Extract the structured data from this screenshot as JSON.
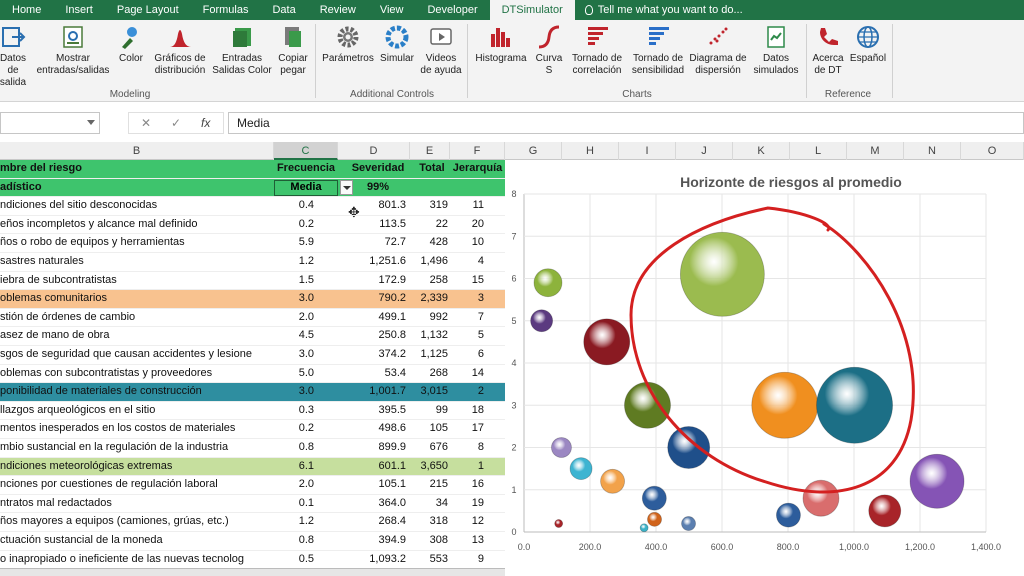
{
  "menu": {
    "tabs": [
      "Home",
      "Insert",
      "Page Layout",
      "Formulas",
      "Data",
      "Review",
      "View",
      "Developer",
      "DTSimulator"
    ],
    "active": "DTSimulator",
    "tell_me": "Tell me what you want to do..."
  },
  "ribbon": {
    "buttons": [
      {
        "label": "Datos\nde salida",
        "icon": "data-output-icon"
      },
      {
        "label": "Mostrar\nentradas/salidas",
        "icon": "show-io-icon"
      },
      {
        "label": "Color",
        "icon": "color-icon"
      },
      {
        "label": "Gráficos de\ndistribución",
        "icon": "distribution-icon"
      },
      {
        "label": "Entradas\nSalidas Color",
        "icon": "io-color-icon"
      },
      {
        "label": "Copiar\npegar",
        "icon": "copy-paste-icon"
      },
      {
        "label": "Parámetros",
        "icon": "gear-icon"
      },
      {
        "label": "Simular",
        "icon": "simulate-icon"
      },
      {
        "label": "Videos\nde ayuda",
        "icon": "video-icon"
      },
      {
        "label": "Histograma",
        "icon": "histogram-icon"
      },
      {
        "label": "Curva\nS",
        "icon": "s-curve-icon"
      },
      {
        "label": "Tornado de\ncorrelación",
        "icon": "tornado-correlation-icon"
      },
      {
        "label": "Tornado de\nsensibilidad",
        "icon": "tornado-sensitivity-icon"
      },
      {
        "label": "Diagrama de\ndispersión",
        "icon": "scatter-icon"
      },
      {
        "label": "Datos\nsimulados",
        "icon": "simulated-data-icon"
      },
      {
        "label": "Acerca\nde DT",
        "icon": "about-icon"
      },
      {
        "label": "Español",
        "icon": "globe-icon"
      }
    ],
    "groups": [
      "Modeling",
      "Additional Controls",
      "Charts",
      "Reference"
    ]
  },
  "formula_bar": {
    "value": "Media",
    "fx": "fx"
  },
  "columns": [
    "B",
    "C",
    "D",
    "E",
    "F",
    "G",
    "H",
    "I",
    "J",
    "K",
    "L",
    "M",
    "N",
    "O"
  ],
  "table": {
    "header1": {
      "b": "mbre del riesgo",
      "c": "Frecuencia",
      "d": "Severidad",
      "e": "Total",
      "f": "Jerarquía"
    },
    "header2": {
      "b": "adístico",
      "c": "Media",
      "d": "99%"
    },
    "rows": [
      {
        "b": "ndiciones del sitio desconocidas",
        "c": "0.4",
        "d": "801.3",
        "e": "319",
        "f": "11",
        "hl": ""
      },
      {
        "b": "eños incompletos y alcance mal definido",
        "c": "0.2",
        "d": "113.5",
        "e": "22",
        "f": "20",
        "hl": ""
      },
      {
        "b": "ños o robo de equipos y herramientas",
        "c": "5.9",
        "d": "72.7",
        "e": "428",
        "f": "10",
        "hl": ""
      },
      {
        "b": "sastres naturales",
        "c": "1.2",
        "d": "1,251.6",
        "e": "1,496",
        "f": "4",
        "hl": ""
      },
      {
        "b": "iebra de subcontratistas",
        "c": "1.5",
        "d": "172.9",
        "e": "258",
        "f": "15",
        "hl": ""
      },
      {
        "b": "oblemas comunitarios",
        "c": "3.0",
        "d": "790.2",
        "e": "2,339",
        "f": "3",
        "hl": "#f8c28f"
      },
      {
        "b": "stión de órdenes de cambio",
        "c": "2.0",
        "d": "499.1",
        "e": "992",
        "f": "7",
        "hl": ""
      },
      {
        "b": "asez de mano de obra",
        "c": "4.5",
        "d": "250.8",
        "e": "1,132",
        "f": "5",
        "hl": ""
      },
      {
        "b": "sgos de seguridad que causan accidentes y lesione",
        "c": "3.0",
        "d": "374.2",
        "e": "1,125",
        "f": "6",
        "hl": ""
      },
      {
        "b": "oblemas con subcontratistas y proveedores",
        "c": "5.0",
        "d": "53.4",
        "e": "268",
        "f": "14",
        "hl": ""
      },
      {
        "b": "ponibilidad de materiales de construcción",
        "c": "3.0",
        "d": "1,001.7",
        "e": "3,015",
        "f": "2",
        "hl": "#2e8ea0"
      },
      {
        "b": "llazgos arqueológicos en el sitio",
        "c": "0.3",
        "d": "395.5",
        "e": "99",
        "f": "18",
        "hl": ""
      },
      {
        "b": "mentos inesperados en los costos de materiales",
        "c": "0.2",
        "d": "498.6",
        "e": "105",
        "f": "17",
        "hl": ""
      },
      {
        "b": "mbio sustancial en la regulación de la industria",
        "c": "0.8",
        "d": "899.9",
        "e": "676",
        "f": "8",
        "hl": ""
      },
      {
        "b": "ndiciones meteorológicas extremas",
        "c": "6.1",
        "d": "601.1",
        "e": "3,650",
        "f": "1",
        "hl": "#c6df9e"
      },
      {
        "b": "nciones por cuestiones de regulación laboral",
        "c": "2.0",
        "d": "105.1",
        "e": "215",
        "f": "16",
        "hl": ""
      },
      {
        "b": "ntratos mal redactados",
        "c": "0.1",
        "d": "364.0",
        "e": "34",
        "f": "19",
        "hl": ""
      },
      {
        "b": "ños mayores a equipos (camiones, grúas, etc.)",
        "c": "1.2",
        "d": "268.4",
        "e": "318",
        "f": "12",
        "hl": ""
      },
      {
        "b": "ctuación sustancial de la moneda",
        "c": "0.8",
        "d": "394.9",
        "e": "308",
        "f": "13",
        "hl": ""
      },
      {
        "b": "o inapropiado o ineficiente de las nuevas tecnolog",
        "c": "0.5",
        "d": "1,093.2",
        "e": "553",
        "f": "9",
        "hl": ""
      }
    ]
  },
  "chart_data": {
    "type": "scatter",
    "title": "Horizonte de riesgos al promedio",
    "xlabel": "",
    "ylabel": "",
    "xlim": [
      0,
      1400
    ],
    "ylim": [
      0,
      8
    ],
    "xticks": [
      "0.0",
      "200.0",
      "400.0",
      "600.0",
      "800.0",
      "1,000.0",
      "1,200.0",
      "1,400.0"
    ],
    "yticks": [
      "0",
      "1",
      "2",
      "3",
      "4",
      "5",
      "6",
      "7",
      "8"
    ],
    "grid": true,
    "annotation": "red freehand circle around the largest-risk bubbles",
    "points": [
      {
        "x": 72.7,
        "y": 5.9,
        "r": 14,
        "color": "#8db33c"
      },
      {
        "x": 53.4,
        "y": 5.0,
        "r": 11,
        "color": "#5b3a80"
      },
      {
        "x": 250.8,
        "y": 4.5,
        "r": 23,
        "color": "#8a1a22"
      },
      {
        "x": 601.1,
        "y": 6.1,
        "r": 42,
        "color": "#9bbb4f"
      },
      {
        "x": 374.2,
        "y": 3.0,
        "r": 23,
        "color": "#5f7b22"
      },
      {
        "x": 790.2,
        "y": 3.0,
        "r": 33,
        "color": "#f08f1f"
      },
      {
        "x": 1001.7,
        "y": 3.0,
        "r": 38,
        "color": "#1c6f86"
      },
      {
        "x": 499.1,
        "y": 2.0,
        "r": 21,
        "color": "#1f4f8a"
      },
      {
        "x": 113.5,
        "y": 2.0,
        "r": 10,
        "color": "#9b87c2"
      },
      {
        "x": 172.9,
        "y": 1.5,
        "r": 11,
        "color": "#3db4d1"
      },
      {
        "x": 268.4,
        "y": 1.2,
        "r": 12,
        "color": "#f2a24a"
      },
      {
        "x": 1251.6,
        "y": 1.2,
        "r": 27,
        "color": "#8554b5"
      },
      {
        "x": 899.9,
        "y": 0.8,
        "r": 18,
        "color": "#d96d6d"
      },
      {
        "x": 394.9,
        "y": 0.8,
        "r": 12,
        "color": "#2d5d9c"
      },
      {
        "x": 801.3,
        "y": 0.4,
        "r": 12,
        "color": "#2d5d9c"
      },
      {
        "x": 1093.2,
        "y": 0.5,
        "r": 16,
        "color": "#a82429"
      },
      {
        "x": 498.6,
        "y": 0.2,
        "r": 7,
        "color": "#5b7fb0"
      },
      {
        "x": 395.5,
        "y": 0.3,
        "r": 7,
        "color": "#d0631b"
      },
      {
        "x": 364.0,
        "y": 0.1,
        "r": 4,
        "color": "#3cb2c8"
      },
      {
        "x": 105.1,
        "y": 0.2,
        "r": 4,
        "color": "#a82429"
      }
    ]
  }
}
